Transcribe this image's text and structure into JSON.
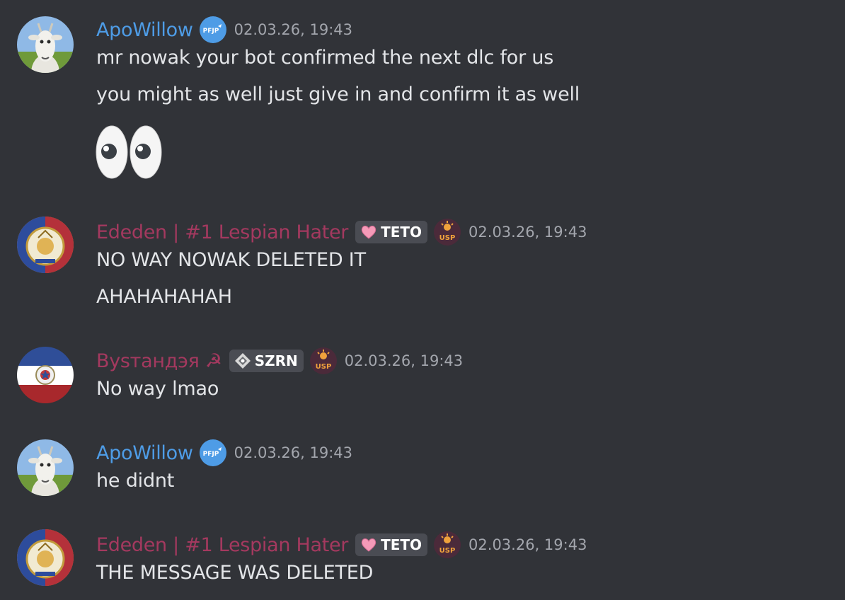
{
  "messages": [
    {
      "username": "ApoWillow",
      "timestamp": "02.03.26, 19:43",
      "role_badge": "PFJP",
      "lines": [
        "mr nowak your bot confirmed the next dlc for us",
        "you might as well just give in and confirm it as well"
      ],
      "emoji": "eyes-emoji"
    },
    {
      "username": "Ededen | #1 Lespian Hater",
      "timestamp": "02.03.26, 19:43",
      "tag": "TETO",
      "guild_badge": "USP",
      "lines": [
        "NO WAY NOWAK DELETED IT",
        "AHAHAHAHAH"
      ]
    },
    {
      "username": "Bysтaндэя ☭",
      "timestamp": "02.03.26, 19:43",
      "tag": "SZRN",
      "guild_badge": "USP",
      "lines": [
        "No way lmao"
      ]
    },
    {
      "username": "ApoWillow",
      "timestamp": "02.03.26, 19:43",
      "role_badge": "PFJP",
      "lines": [
        "he didnt"
      ]
    },
    {
      "username": "Ededen | #1 Lespian Hater",
      "timestamp": "02.03.26, 19:43",
      "tag": "TETO",
      "guild_badge": "USP",
      "lines": [
        "THE MESSAGE WAS DELETED"
      ]
    }
  ],
  "colors": {
    "background": "#313338",
    "username_blue": "#4e9ce6",
    "username_red": "#a4395f",
    "timestamp": "#a3a6ad",
    "text": "#e3e5e8"
  }
}
